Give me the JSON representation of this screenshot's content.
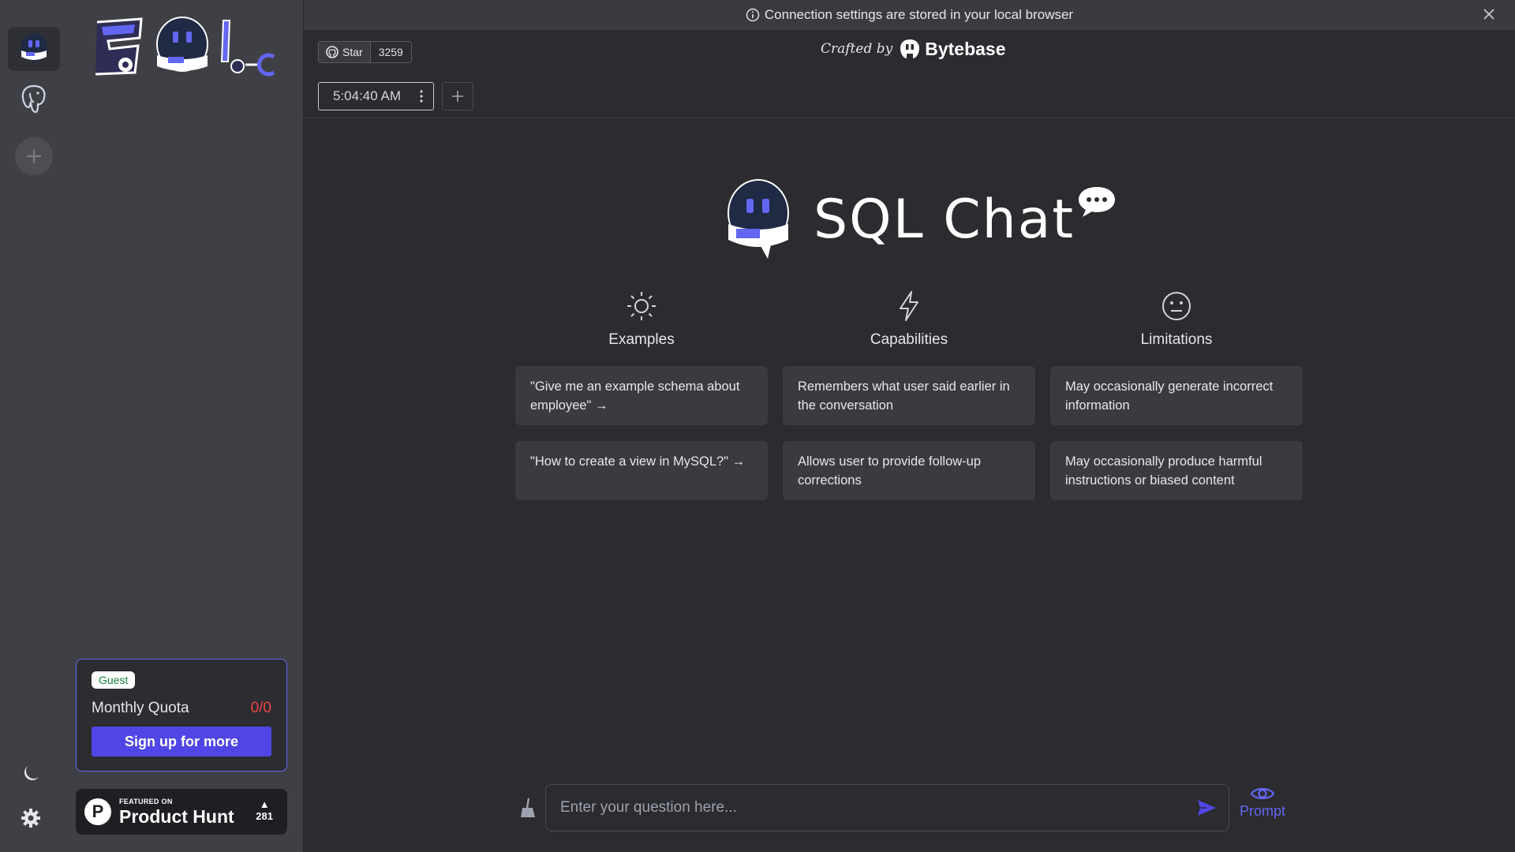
{
  "banner": {
    "text": "Connection settings are stored in your local browser"
  },
  "github": {
    "star_label": "Star",
    "star_count": "3259"
  },
  "header": {
    "crafted_by": "Crafted by",
    "brand": "Bytebase"
  },
  "conversation": {
    "tab_label": "5:04:40 AM"
  },
  "hero": {
    "title": "SQL Chat"
  },
  "columns": [
    {
      "title": "Examples",
      "icon": "sun-icon",
      "items": [
        "\"Give me an example schema about employee\" →",
        "\"How to create a view in MySQL?\" →"
      ]
    },
    {
      "title": "Capabilities",
      "icon": "lightning-icon",
      "items": [
        "Remembers what user said earlier in the conversation",
        "Allows user to provide follow-up corrections"
      ]
    },
    {
      "title": "Limitations",
      "icon": "neutral-face-icon",
      "items": [
        "May occasionally generate incorrect information",
        "May occasionally produce harmful instructions or biased content"
      ]
    }
  ],
  "quota": {
    "badge": "Guest",
    "label": "Monthly Quota",
    "value": "0/0",
    "signup": "Sign up for more"
  },
  "product_hunt": {
    "featured": "FEATURED ON",
    "name": "Product Hunt",
    "votes": "281"
  },
  "input": {
    "placeholder": "Enter your question here..."
  },
  "prompt": {
    "label": "Prompt"
  },
  "colors": {
    "accent": "#4f46e5",
    "background": "#2b2b30",
    "sidebar": "#3f4045",
    "error": "#ef4444"
  }
}
